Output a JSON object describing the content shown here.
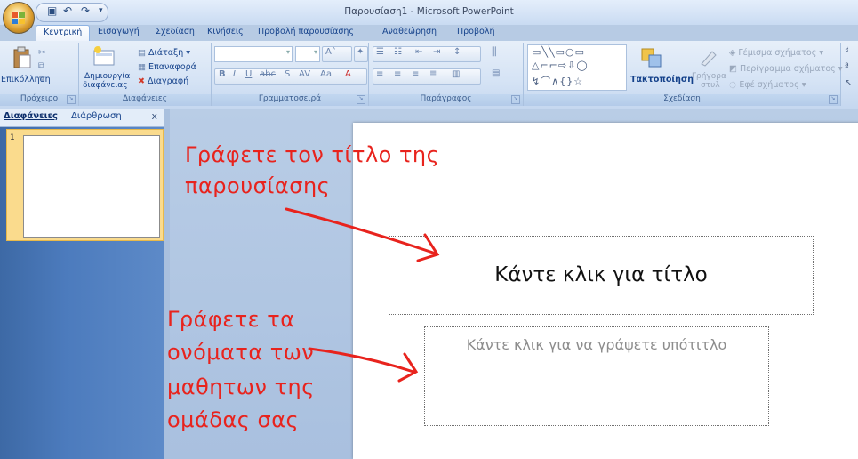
{
  "window": {
    "title": "Παρουσίαση1 - Microsoft PowerPoint"
  },
  "tabs": [
    "Κεντρική",
    "Εισαγωγή",
    "Σχεδίαση",
    "Κινήσεις",
    "Προβολή παρουσίασης",
    "Αναθεώρηση",
    "Προβολή"
  ],
  "ribbon": {
    "clipboard": {
      "paste": "Επικόλληση",
      "label": "Πρόχειρο"
    },
    "slides": {
      "new_slide_1": "Δημιουργία",
      "new_slide_2": "διαφάνειας",
      "layout": "Διάταξη",
      "reset": "Επαναφορά",
      "delete": "Διαγραφή",
      "label": "Διαφάνειες"
    },
    "font": {
      "label": "Γραμματοσειρά"
    },
    "paragraph": {
      "label": "Παράγραφος"
    },
    "drawing": {
      "arrange": "Τακτοποίηση",
      "quick_styles_1": "Γρήγορα",
      "quick_styles_2": "στυλ",
      "fill": "Γέμισμα σχήματος",
      "outline": "Περίγραμμα σχήματος",
      "effects": "Εφέ σχήματος",
      "label": "Σχεδίαση"
    }
  },
  "pane": {
    "tab_slides": "Διαφάνειες",
    "tab_outline": "Διάρθρωση",
    "close": "x",
    "thumb_number": "1"
  },
  "slide": {
    "title_placeholder": "Κάντε κλικ για τίτλο",
    "subtitle_placeholder": "Κάντε κλικ για να γράψετε υπότιτλο"
  },
  "annotations": {
    "title_note_1": "Γράφετε τον τίτλο της",
    "title_note_2": "παρουσίασης",
    "names_note_1": "Γράφετε τα",
    "names_note_2": "ονόματα των",
    "names_note_3": "μαθητων της",
    "names_note_4": "ομάδας σας"
  },
  "colors": {
    "annotation_red": "#e8231d",
    "ribbon_text": "#15428b",
    "pane_blue": "#4c7bbd"
  }
}
